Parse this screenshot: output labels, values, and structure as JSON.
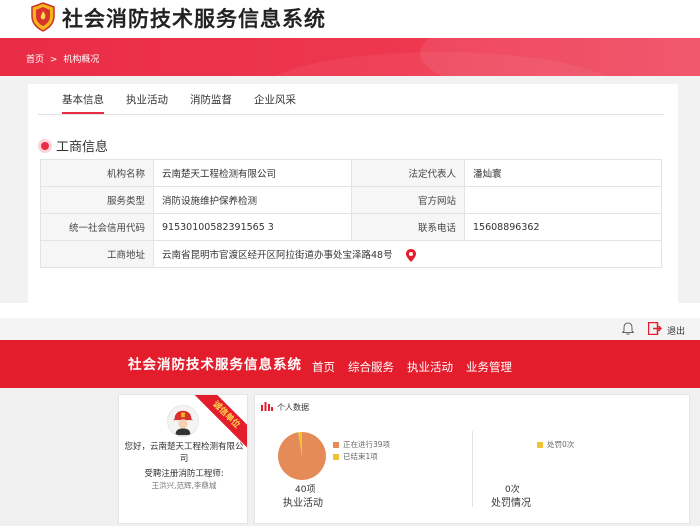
{
  "top": {
    "app_title": "社会消防技术服务信息系统",
    "breadcrumb": {
      "home": "首页",
      "sep": ">",
      "current": "机构概况"
    },
    "tabs": [
      "基本信息",
      "执业活动",
      "消防监督",
      "企业风采"
    ],
    "section_title": "工商信息",
    "info": {
      "org_name_label": "机构名称",
      "org_name": "云南楚天工程检测有限公司",
      "legal_rep_label": "法定代表人",
      "legal_rep": "潘灿寰",
      "service_type_label": "服务类型",
      "service_type": "消防设施维护保养检测",
      "website_label": "官方网站",
      "website": "",
      "credit_code_label": "统一社会信用代码",
      "credit_code": "91530100582391565 3",
      "phone_label": "联系电话",
      "phone": "15608896362",
      "address_label": "工商地址",
      "address": "云南省昆明市官渡区经开区阿拉街道办事处宝泽路48号"
    }
  },
  "bottom": {
    "exit_label": "退出",
    "app_title": "社会消防技术服务信息系统",
    "nav": [
      "首页",
      "综合服务",
      "执业活动",
      "业务管理"
    ],
    "profile": {
      "ribbon": "诚信单位",
      "greeting": "您好，云南楚天工程检测有限公司",
      "role": "受聘注册消防工程师:",
      "names": "王洪兴,范辉,李鼎城"
    },
    "stats": {
      "title": "个人数据",
      "legend_ongoing": "正在进行39项",
      "legend_done": "已结束1项",
      "activity_count": "40项",
      "activity_caption": "执业活动",
      "penalty_legend": "处罚0次",
      "penalty_count": "0次",
      "penalty_caption": "处罚情况"
    }
  },
  "chart_data": {
    "type": "pie",
    "categories": [
      "正在进行",
      "已结束"
    ],
    "values": [
      39,
      1
    ]
  },
  "colors": {
    "brand_red": "#e41d2d",
    "pie_main": "#e58b58",
    "pie_minor": "#f1c232"
  }
}
